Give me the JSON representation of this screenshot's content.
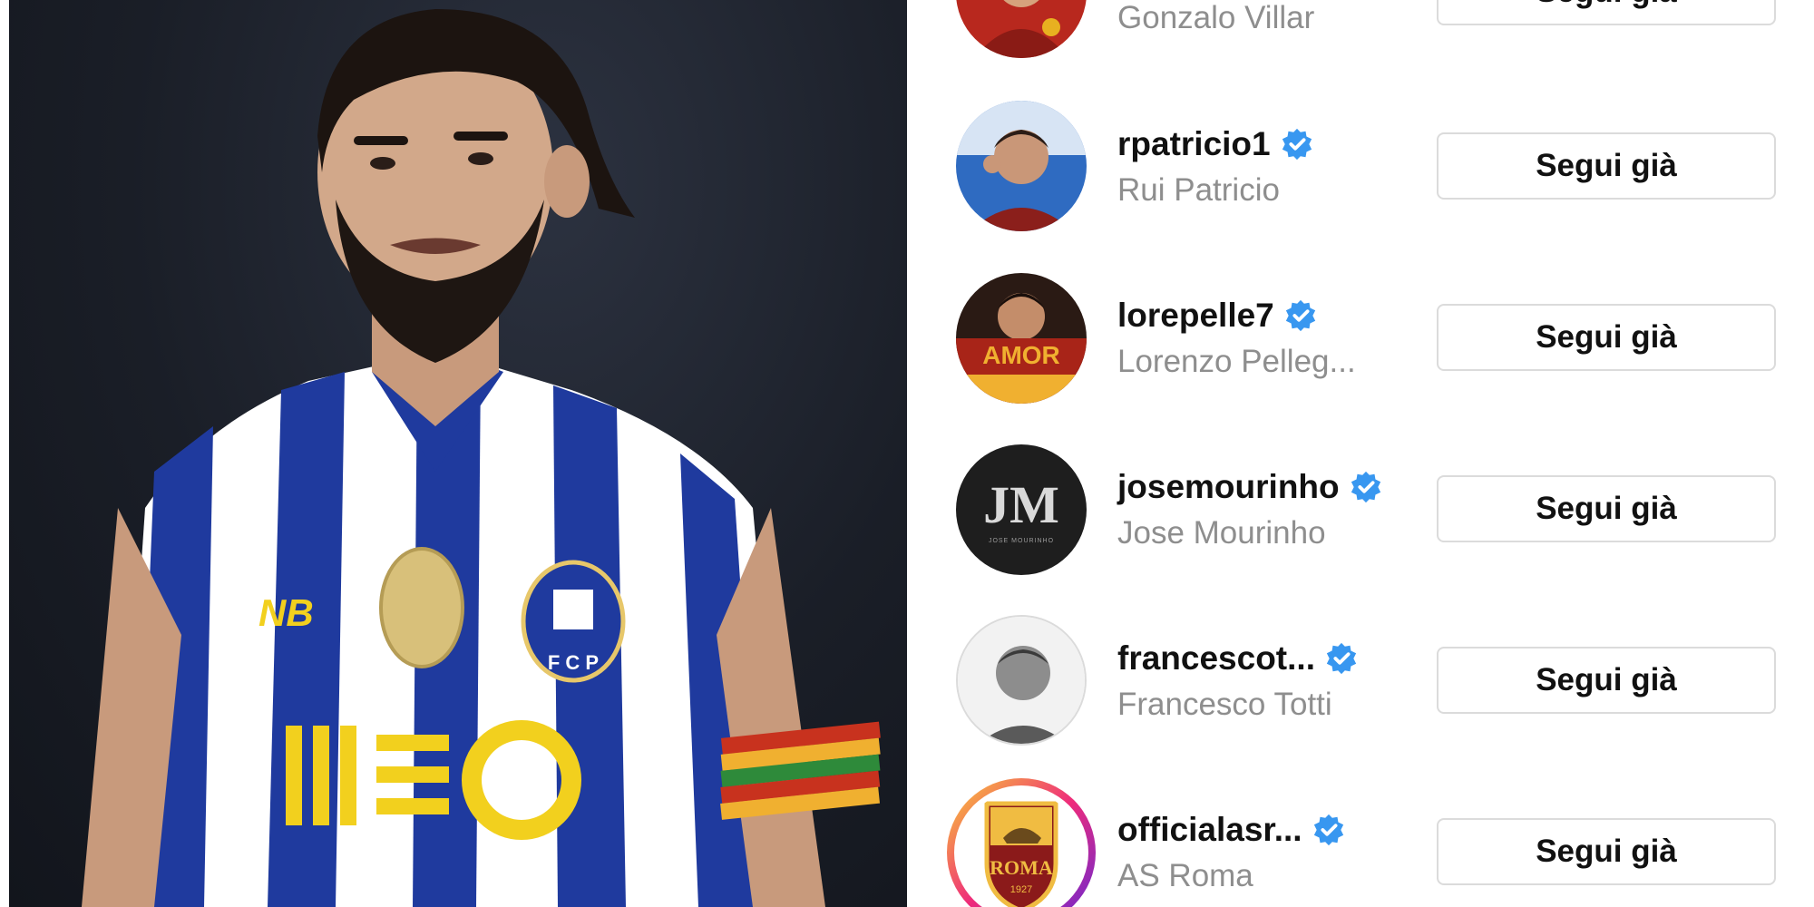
{
  "following_list": [
    {
      "username": "",
      "full_name": "Gonzalo Villar",
      "verified": false,
      "button_label": "Segui già",
      "avatar": "gonzalo-villar-avatar"
    },
    {
      "username": "rpatricio1",
      "full_name": "Rui Patricio",
      "verified": true,
      "button_label": "Segui già",
      "avatar": "rui-patricio-avatar"
    },
    {
      "username": "lorepelle7",
      "full_name": "Lorenzo Pelleg...",
      "verified": true,
      "button_label": "Segui già",
      "avatar": "lorenzo-pellegrini-avatar",
      "avatar_text": "AMOR"
    },
    {
      "username": "josemourinho",
      "full_name": "Jose Mourinho",
      "verified": true,
      "button_label": "Segui già",
      "avatar": "jose-mourinho-logo-avatar",
      "avatar_text": "JM",
      "avatar_subtext": "JOSE MOURINHO"
    },
    {
      "username": "francescot...",
      "full_name": "Francesco Totti",
      "verified": true,
      "button_label": "Segui già",
      "avatar": "francesco-totti-avatar"
    },
    {
      "username": "officialasr...",
      "full_name": "AS Roma",
      "verified": true,
      "button_label": "Segui già",
      "avatar": "as-roma-crest-avatar",
      "avatar_text": "ROMA",
      "avatar_subtext": "1927",
      "story_ring": true
    }
  ],
  "photo": {
    "subject": "player-photo",
    "shirt_text": "",
    "badge_text": "F C P"
  },
  "colors": {
    "verified_blue": "#3897f0",
    "secondary_text": "#8e8e8e",
    "button_border": "#dbdbdb",
    "shirt_blue": "#1f3a9e",
    "roma_red": "#8b1a1a",
    "roma_gold": "#f0bc42"
  }
}
